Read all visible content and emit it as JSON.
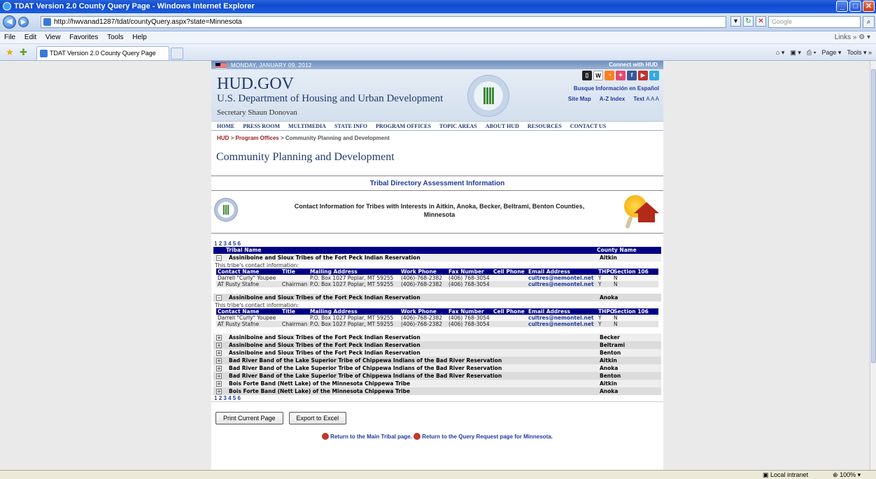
{
  "window": {
    "title": "TDAT Version 2.0 County Query Page - Windows Internet Explorer",
    "url": "http://hwvanad1287/tdat/countyQuery.aspx?state=Minnesota",
    "search_placeholder": "Google",
    "tab_label": "TDAT Version 2.0 County Query Page",
    "menu": [
      "File",
      "Edit",
      "View",
      "Favorites",
      "Tools",
      "Help"
    ],
    "links_label": "Links",
    "cmd_items": [
      "Page",
      "Tools"
    ],
    "status_zone": "Local intranet",
    "zoom": "100%"
  },
  "hud": {
    "date": "MONDAY, JANUARY 09, 2012",
    "logo": "HUD.GOV",
    "dept": "U.S. Department of Housing and Urban Development",
    "secretary": "Secretary Shaun Donovan",
    "connect": "Connect with HUD",
    "espanol": "Busque Información en Español",
    "site_map": "Site Map",
    "az_index": "A-Z Index",
    "text_size": "Text",
    "text_sizes": "A A A",
    "nav": [
      "HOME",
      "PRESS ROOM",
      "MULTIMEDIA",
      "STATE INFO",
      "PROGRAM OFFICES",
      "TOPIC AREAS",
      "ABOUT HUD",
      "RESOURCES",
      "CONTACT US"
    ]
  },
  "breadcrumb": {
    "hud": "HUD",
    "sep": ">",
    "program_offices": "Program Offices",
    "current": "Community Planning and Development"
  },
  "page_title": "Community Planning and Development",
  "section_title": "Tribal Directory Assessment Information",
  "contact_heading": "Contact Information for Tribes with Interests in Aitkin, Anoka, Becker, Beltrami, Benton Counties, Minnesota",
  "pager": [
    "1",
    "2",
    "3",
    "4",
    "5",
    "6"
  ],
  "grid": {
    "col_tribe": "Tribal Name",
    "col_county": "County Name",
    "sub_label": "This tribe's contact information:",
    "sub_headers": [
      "Contact Name",
      "Title",
      "Mailing Address",
      "Work Phone",
      "Fax Number",
      "Cell Phone",
      "Email Address",
      "THPO",
      "Section 106"
    ],
    "contacts": [
      {
        "name": "Darrell \"Curly\" Youpee",
        "title": "",
        "address": "P.O. Box 1027 Poplar, MT 59255",
        "work": "(406)-768-2382",
        "fax": "(406) 768-3054",
        "cell": "",
        "email": "cultres@nemontel.net",
        "thpo": "Y",
        "s106": "N"
      },
      {
        "name": "AT Rusty Stafne",
        "title": "Chairman",
        "address": "P.O. Box 1027 Poplar, MT 59255",
        "work": "(406)-768-2382",
        "fax": "(406) 768-3054",
        "cell": "",
        "email": "cultres@nemontel.net",
        "thpo": "Y",
        "s106": "N"
      }
    ],
    "rows": [
      {
        "tribe": "Assiniboine and Sioux Tribes of the Fort Peck Indian Reservation",
        "county": "Aitkin"
      },
      {
        "tribe": "Assiniboine and Sioux Tribes of the Fort Peck Indian Reservation",
        "county": "Anoka"
      },
      {
        "tribe": "Assiniboine and Sioux Tribes of the Fort Peck Indian Reservation",
        "county": "Becker"
      },
      {
        "tribe": "Assiniboine and Sioux Tribes of the Fort Peck Indian Reservation",
        "county": "Beltrami"
      },
      {
        "tribe": "Assiniboine and Sioux Tribes of the Fort Peck Indian Reservation",
        "county": "Benton"
      },
      {
        "tribe": "Bad River Band of the Lake Superior Tribe of Chippewa Indians of the Bad River Reservation",
        "county": "Aitkin"
      },
      {
        "tribe": "Bad River Band of the Lake Superior Tribe of Chippewa Indians of the Bad River Reservation",
        "county": "Anoka"
      },
      {
        "tribe": "Bad River Band of the Lake Superior Tribe of Chippewa Indians of the Bad River Reservation",
        "county": "Benton"
      },
      {
        "tribe": "Bois Forte Band (Nett Lake) of the Minnesota Chippewa Tribe",
        "county": "Aitkin"
      },
      {
        "tribe": "Bois Forte Band (Nett Lake) of the Minnesota Chippewa Tribe",
        "county": "Anoka"
      }
    ]
  },
  "buttons": {
    "print": "Print Current Page",
    "export": "Export to Excel"
  },
  "return_main": "Return to the Main Tribal page.",
  "return_query": "Return to the Query Request page for Minnesota."
}
